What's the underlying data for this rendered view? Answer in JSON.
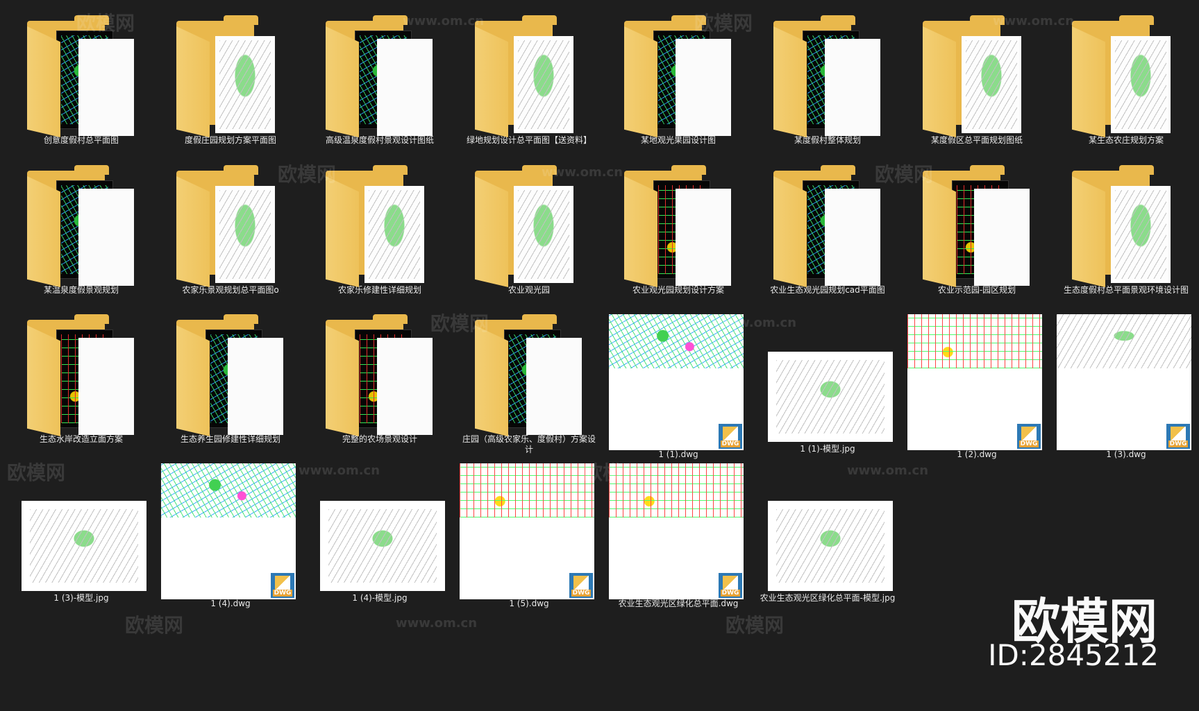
{
  "items": [
    {
      "type": "folder",
      "label": "创意度假村总平面图",
      "variant": "a",
      "dark": true
    },
    {
      "type": "folder",
      "label": "度假庄园规划方案平面图",
      "variant": "c",
      "dark": false
    },
    {
      "type": "folder",
      "label": "高级温泉度假村景观设计图纸",
      "variant": "a",
      "dark": true
    },
    {
      "type": "folder",
      "label": "绿地规划设计总平面图【送资料】",
      "variant": "c",
      "dark": false
    },
    {
      "type": "folder",
      "label": "某地观光果园设计图",
      "variant": "a",
      "dark": true
    },
    {
      "type": "folder",
      "label": "某度假村整体规划",
      "variant": "a",
      "dark": true
    },
    {
      "type": "folder",
      "label": "某度假区总平面规划图纸",
      "variant": "c",
      "dark": false
    },
    {
      "type": "folder",
      "label": "某生态农庄规划方案",
      "variant": "c",
      "dark": false
    },
    {
      "type": "folder",
      "label": "某温泉度假景观规划",
      "variant": "a",
      "dark": true
    },
    {
      "type": "folder",
      "label": "农家乐景观规划总平面图o",
      "variant": "c",
      "dark": false
    },
    {
      "type": "folder",
      "label": "农家乐修建性详细规划",
      "variant": "c",
      "dark": false
    },
    {
      "type": "folder",
      "label": "农业观光园",
      "variant": "c",
      "dark": false
    },
    {
      "type": "folder",
      "label": "农业观光园规划设计方案",
      "variant": "b",
      "dark": true
    },
    {
      "type": "folder",
      "label": "农业生态观光园规划cad平面图",
      "variant": "a",
      "dark": true
    },
    {
      "type": "folder",
      "label": "农业示范园-园区规划",
      "variant": "b",
      "dark": true
    },
    {
      "type": "folder",
      "label": "生态度假村总平面景观环境设计图",
      "variant": "c",
      "dark": false
    },
    {
      "type": "folder",
      "label": "生态水岸改造立面方案",
      "variant": "b",
      "dark": true
    },
    {
      "type": "folder",
      "label": "生态养生园修建性详细规划",
      "variant": "a",
      "dark": true
    },
    {
      "type": "folder",
      "label": "完整的农场景观设计",
      "variant": "b",
      "dark": true
    },
    {
      "type": "folder",
      "label": "庄园（高级农家乐、度假村）方案设计",
      "variant": "a",
      "dark": true
    },
    {
      "type": "dwg",
      "label": "1 (1).dwg",
      "variant": "a"
    },
    {
      "type": "jpg",
      "label": "1 (1)-模型.jpg",
      "variant": "c"
    },
    {
      "type": "dwg",
      "label": "1 (2).dwg",
      "variant": "b"
    },
    {
      "type": "dwg",
      "label": "1 (3).dwg",
      "variant": "c"
    },
    {
      "type": "jpg",
      "label": "1 (3)-模型.jpg",
      "variant": "c"
    },
    {
      "type": "dwg",
      "label": "1 (4).dwg",
      "variant": "a"
    },
    {
      "type": "jpg",
      "label": "1 (4)-模型.jpg",
      "variant": "c"
    },
    {
      "type": "dwg",
      "label": "1 (5).dwg",
      "variant": "b"
    },
    {
      "type": "dwg",
      "label": "农业生态观光区绿化总平面.dwg",
      "variant": "b"
    },
    {
      "type": "jpg",
      "label": "农业生态观光区绿化总平面-模型.jpg",
      "variant": "c"
    }
  ],
  "badge_text": "DWG",
  "watermark": {
    "cn": "欧模网",
    "url": "www.om.cn"
  },
  "brand": {
    "name": "欧模网",
    "id": "ID:2845212"
  },
  "colors": {
    "background": "#1e1e1e",
    "folder": "#e9b84c",
    "label": "#e8e8e8"
  }
}
